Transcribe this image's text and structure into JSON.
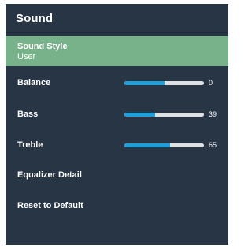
{
  "header": {
    "title": "Sound"
  },
  "menu": {
    "sound_style": {
      "label": "Sound Style",
      "value": "User"
    },
    "balance": {
      "label": "Balance",
      "value": "0",
      "fill_fraction": 0.5
    },
    "bass": {
      "label": "Bass",
      "value": "39",
      "fill_fraction": 0.39
    },
    "treble": {
      "label": "Treble",
      "value": "65",
      "fill_fraction": 0.57
    },
    "equalizer_detail": {
      "label": "Equalizer Detail"
    },
    "reset_to_default": {
      "label": "Reset to Default"
    }
  },
  "colors": {
    "panel_background": "#273545",
    "selected_background": "#77b28a",
    "slider_fill": "#1f9fd8",
    "slider_track": "#dfe2e5"
  }
}
